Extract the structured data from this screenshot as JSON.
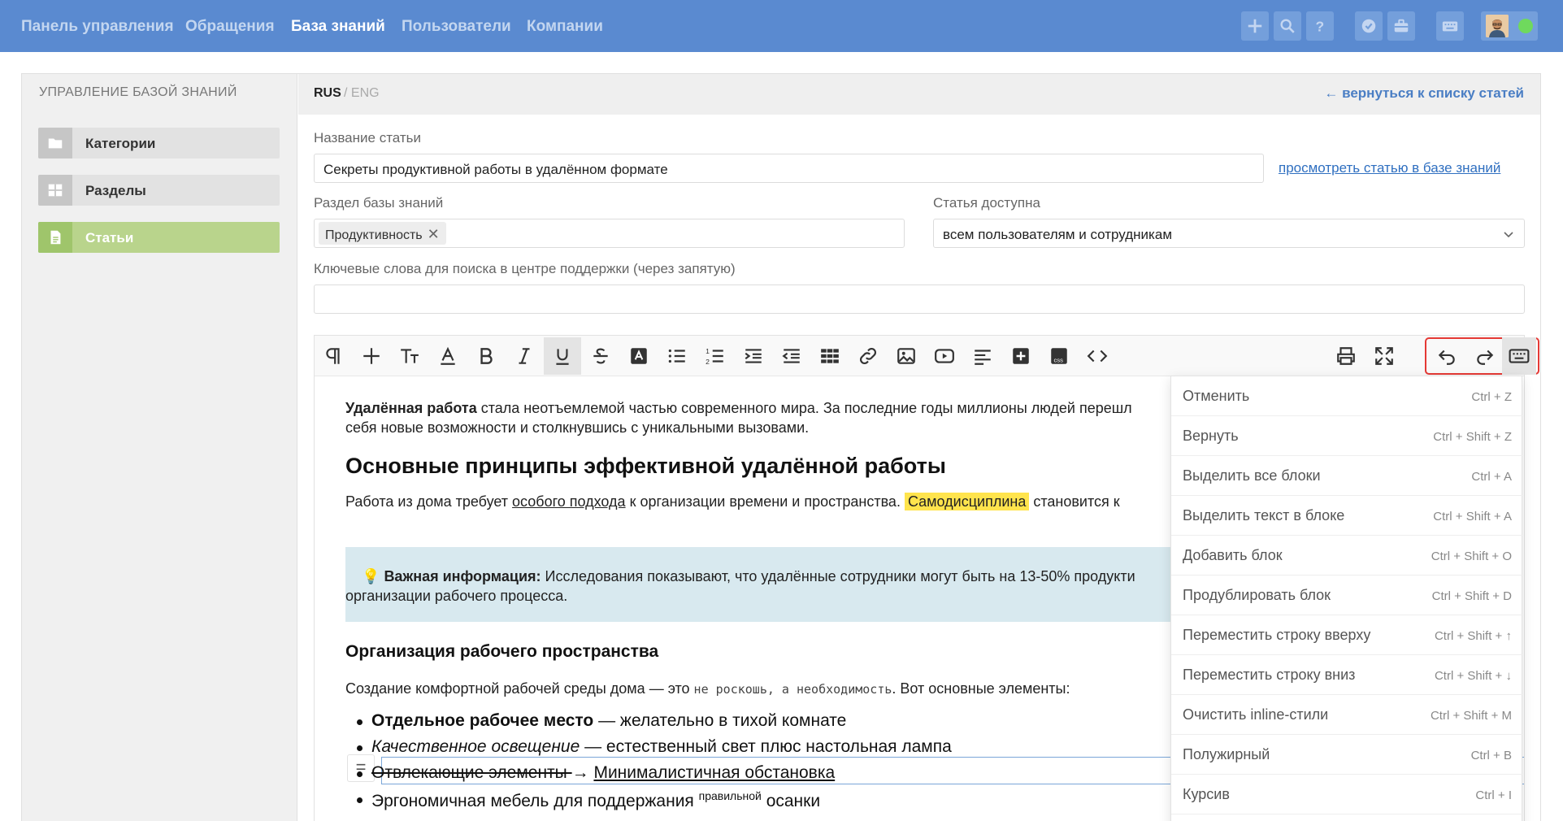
{
  "nav": {
    "items": [
      "Панель управления",
      "Обращения",
      "База знаний",
      "Пользователи",
      "Компании"
    ],
    "active_index": 2,
    "icons": [
      "plus-icon",
      "search-icon",
      "help-icon",
      "check-circle-icon",
      "briefcase-icon",
      "keyboard-icon"
    ]
  },
  "sidebar": {
    "title": "УПРАВЛЕНИЕ БАЗОЙ ЗНАНИЙ",
    "items": [
      {
        "label": "Категории",
        "icon": "folder-icon"
      },
      {
        "label": "Разделы",
        "icon": "grid-icon"
      },
      {
        "label": "Статьи",
        "icon": "document-icon",
        "active": true
      }
    ]
  },
  "header": {
    "lang_active": "RUS",
    "lang_other": "/ ENG",
    "back_link": "← вернуться к списку статей"
  },
  "form": {
    "title_label": "Название статьи",
    "title_value": "Секреты продуктивной работы в удалённом формате",
    "view_link": "просмотреть статью в базе знаний",
    "section_label": "Раздел базы знаний",
    "section_tag": "Продуктивность",
    "access_label": "Статья доступна",
    "access_value": "всем пользователям и сотрудникам",
    "keywords_label": "Ключевые слова для поиска в центре поддержки (через запятую)",
    "keywords_value": ""
  },
  "editor": {
    "p1_bold": "Удалённая работа",
    "p1_rest": " стала неотъемлемой частью современного мира. За последние годы миллионы людей перешл",
    "p1_line2": "себя новые возможности и столкнувшись с уникальными вызовами.",
    "h2": "Основные принципы эффективной удалённой работы",
    "p2_a": "Работа из дома требует ",
    "p2_u": "особого подхода",
    "p2_b": " к организации времени и пространства. ",
    "p2_hl": "Самодисциплина",
    "p2_c": " становится к",
    "callout_emoji": "💡",
    "callout_bold": "Важная информация:",
    "callout_rest": " Исследования показывают, что удалённые сотрудники могут быть на 13-50% продукти",
    "callout_line2": "организации рабочего процесса.",
    "h3": "Организация рабочего пространства",
    "p3_a": "Создание комфортной рабочей среды дома — это ",
    "p3_code": "не роскошь, а необходимость",
    "p3_b": ". Вот основные элементы:",
    "li1_bold": "Отдельное рабочее место",
    "li1_rest": " — желательно в тихой комнате",
    "li2_italic": "Качественное освещение",
    "li2_rest": " — естественный свет плюс настольная лампа",
    "li3_strike": "Отвлекающие элементы ",
    "li3_arrow": "→ ",
    "li3_u": "Минималистичная обстановка",
    "li4_a": "Эргономичная мебель для поддержания ",
    "li4_sup": "правильной",
    "li4_b": " осанки",
    "drag_handle": "="
  },
  "shortcuts": [
    {
      "label": "Отменить",
      "keys": "Ctrl + Z"
    },
    {
      "label": "Вернуть",
      "keys": "Ctrl + Shift + Z"
    },
    {
      "label": "Выделить все блоки",
      "keys": "Ctrl + A"
    },
    {
      "label": "Выделить текст в блоке",
      "keys": "Ctrl + Shift + A"
    },
    {
      "label": "Добавить блок",
      "keys": "Ctrl + Shift + O"
    },
    {
      "label": "Продублировать блок",
      "keys": "Ctrl + Shift + D"
    },
    {
      "label": "Переместить строку вверху",
      "keys": "Ctrl + Shift + ↑"
    },
    {
      "label": "Переместить строку вниз",
      "keys": "Ctrl + Shift + ↓"
    },
    {
      "label": "Очистить inline-стили",
      "keys": "Ctrl + Shift + M"
    },
    {
      "label": "Полужирный",
      "keys": "Ctrl + B"
    },
    {
      "label": "Курсив",
      "keys": "Ctrl + I"
    }
  ],
  "colors": {
    "topbar": "#5a8ad0",
    "active_sidebar": "#b9d48c",
    "highlight": "#ffe44d",
    "callout": "#d8e9ef",
    "history_outline": "#e53935"
  }
}
